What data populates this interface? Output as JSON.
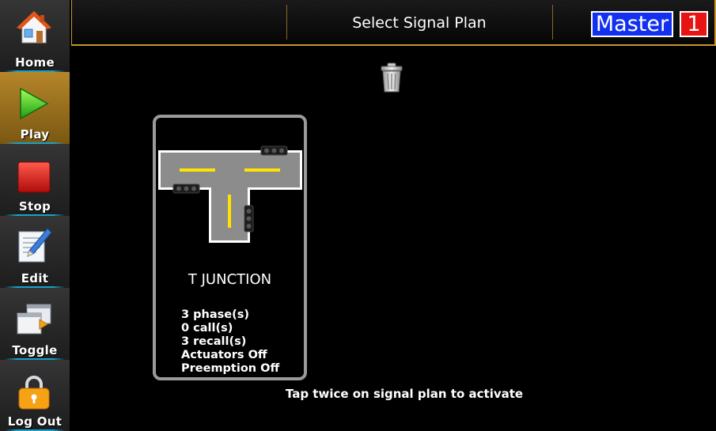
{
  "sidebar": {
    "items": [
      {
        "id": "home",
        "label": "Home",
        "icon": "house-icon"
      },
      {
        "id": "play",
        "label": "Play",
        "icon": "play-icon",
        "active": true
      },
      {
        "id": "stop",
        "label": "Stop",
        "icon": "stop-icon"
      },
      {
        "id": "edit",
        "label": "Edit",
        "icon": "pencil-paper-icon"
      },
      {
        "id": "toggle",
        "label": "Toggle",
        "icon": "windows-toggle-icon"
      },
      {
        "id": "logout",
        "label": "Log Out",
        "icon": "padlock-icon"
      }
    ]
  },
  "header": {
    "title": "Select Signal Plan",
    "mode_label": "Master",
    "mode_number": "1"
  },
  "toolbar": {
    "trash_icon": "trash-can-icon"
  },
  "plan": {
    "name": "T JUNCTION",
    "stats": [
      "3 phase(s)",
      "0 call(s)",
      "3 recall(s)",
      "Actuators Off",
      "Preemption Off"
    ]
  },
  "hint": "Tap twice on signal plan to activate",
  "colors": {
    "accent_border": "#c8962a",
    "active_item": "#b5862a",
    "master_bg": "#1330f0",
    "master_number_bg": "#e81414",
    "road": "#8c8c8c",
    "lane_marking": "#ffe400",
    "separator": "#1aa0c8"
  }
}
